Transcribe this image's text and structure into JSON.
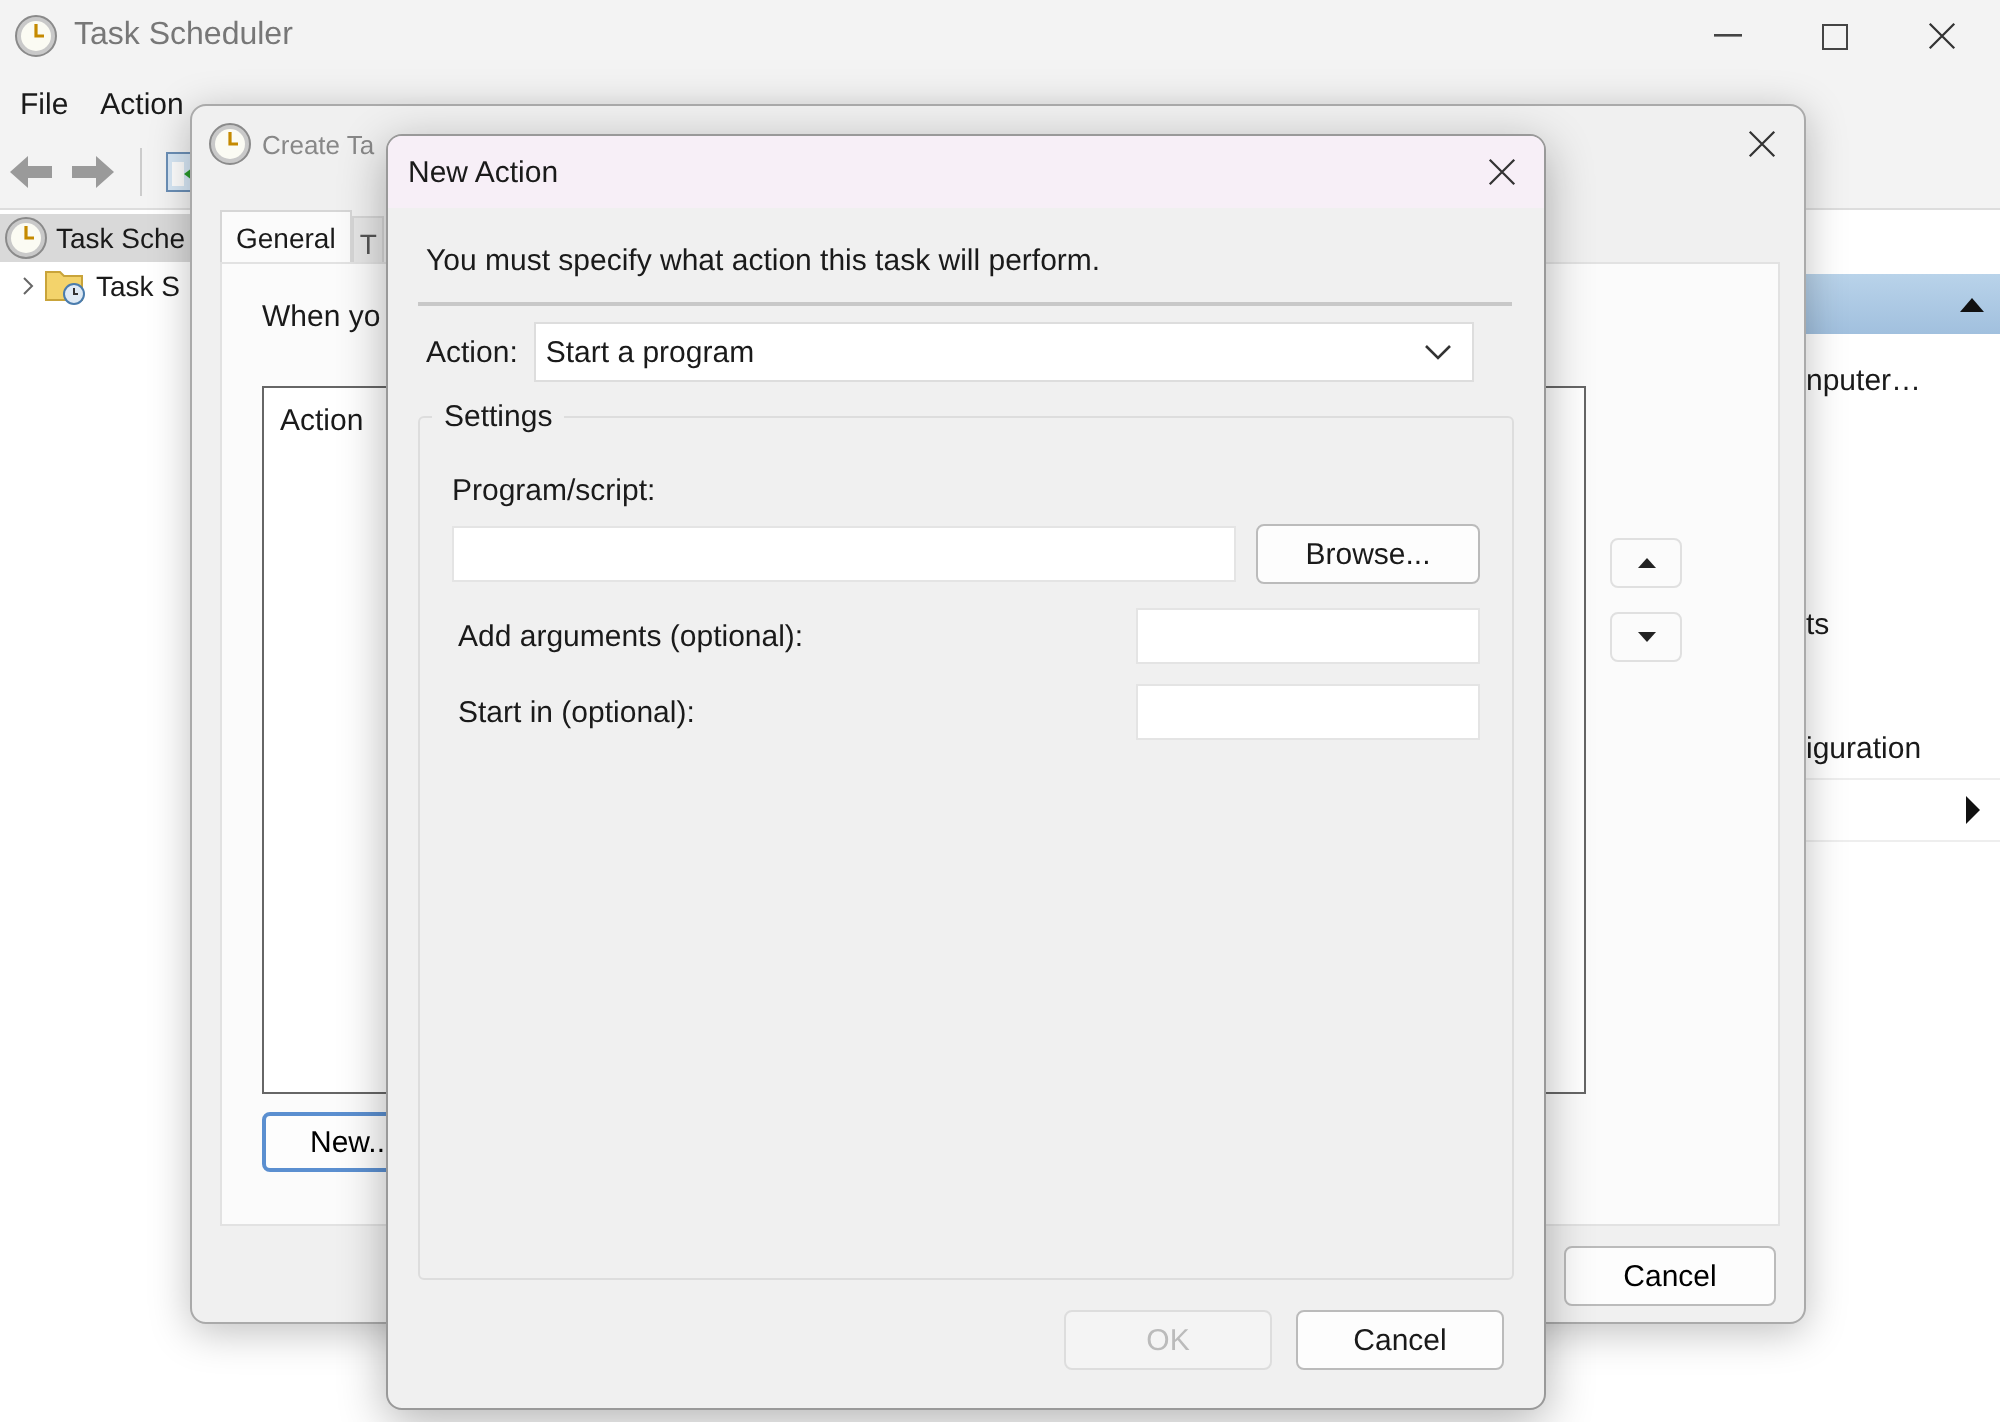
{
  "main_window": {
    "title": "Task Scheduler",
    "menu": [
      "File",
      "Action"
    ],
    "tree": [
      {
        "label": "Task Sche",
        "selected": true,
        "children": [
          {
            "label": "Task S",
            "selected": false,
            "expanded": false
          }
        ]
      }
    ],
    "actions_pane": {
      "expanded": true,
      "items": [
        {
          "kind": "text",
          "label": "nputer…"
        },
        {
          "kind": "text",
          "label": "ts"
        },
        {
          "kind": "text",
          "label": "iguration"
        },
        {
          "kind": "submenu"
        }
      ]
    }
  },
  "create_task": {
    "title": "Create Ta",
    "tabs": [
      {
        "label": "General",
        "selected": true
      },
      {
        "label": "T",
        "selected": false
      }
    ],
    "intro": "When yo",
    "list_column": "Action",
    "new_button": "New..",
    "cancel_button": "Cancel"
  },
  "new_action": {
    "title": "New Action",
    "instruction": "You must specify what action this task will perform.",
    "action_label": "Action:",
    "action_value": "Start a program",
    "group": "Settings",
    "fields": [
      {
        "kind": "wide",
        "label": "Program/script:"
      },
      {
        "kind": "inline",
        "label": "Add arguments (optional):"
      },
      {
        "kind": "inline",
        "label": "Start in (optional):"
      }
    ],
    "browse_button": "Browse...",
    "buttons": [
      {
        "label": "OK",
        "disabled": true
      },
      {
        "label": "Cancel",
        "disabled": false
      }
    ]
  }
}
